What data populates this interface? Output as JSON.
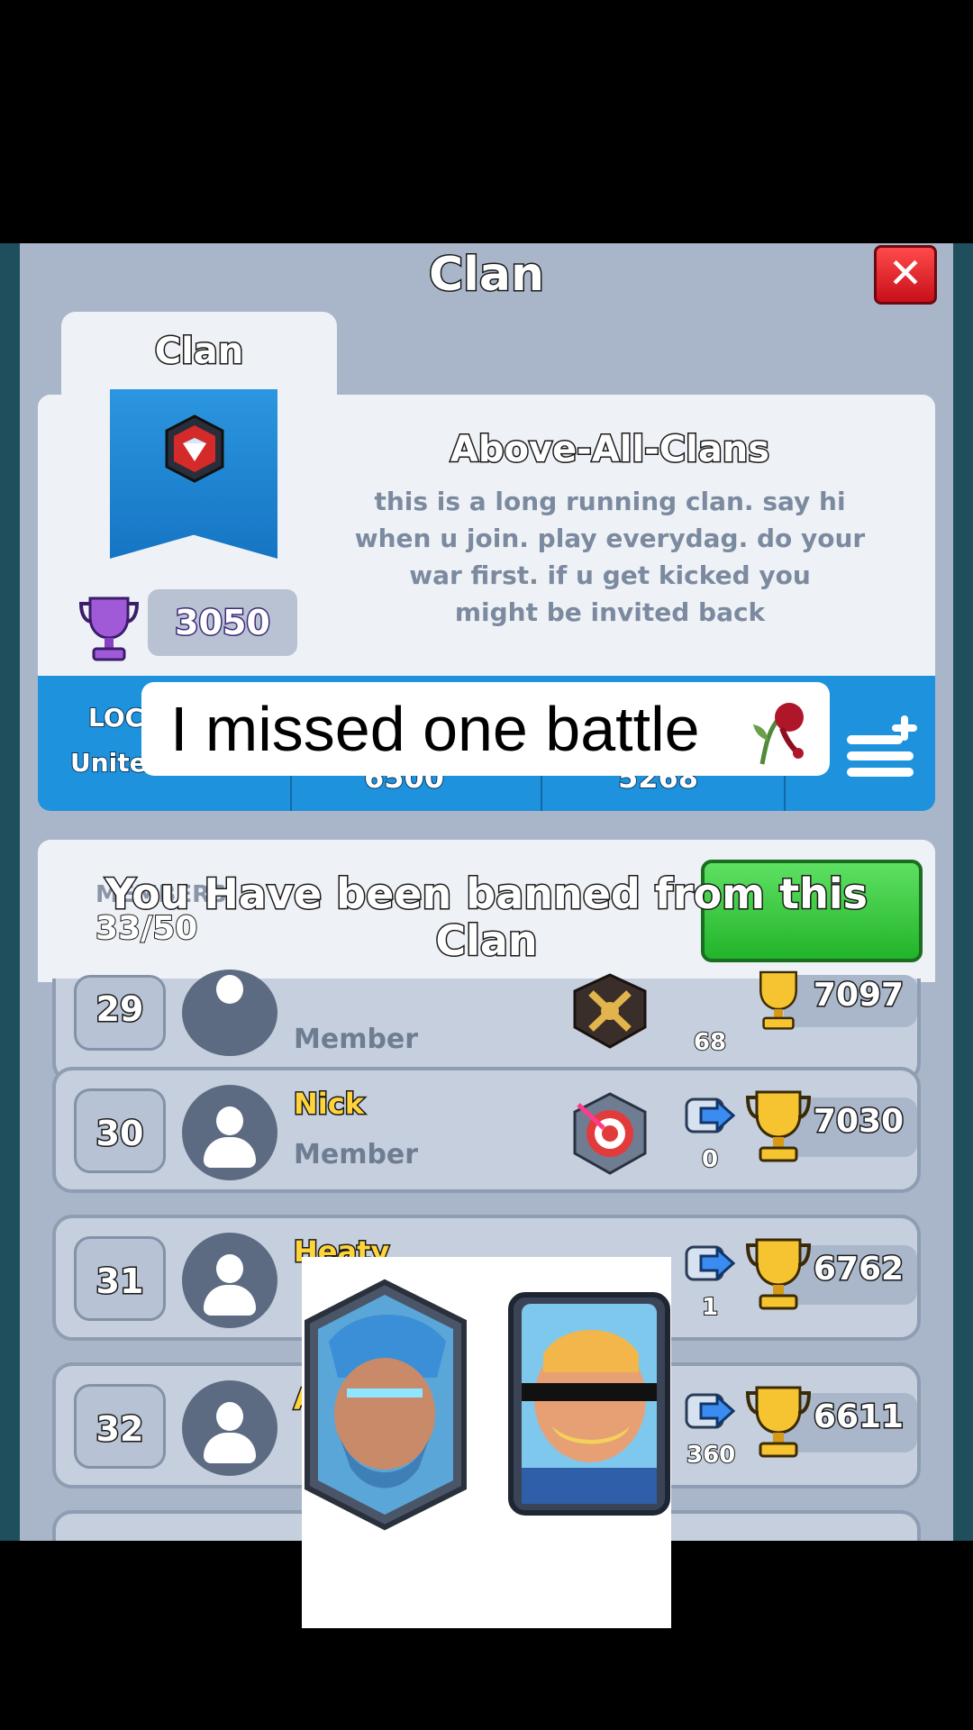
{
  "header": {
    "title": "Clan",
    "close_icon": "close-icon"
  },
  "tabs": [
    {
      "label": "Clan"
    }
  ],
  "clan": {
    "name": "Above-All-Clans",
    "description_lines": [
      "this is a long running clan. say hi",
      "when u join. play everydag. do your",
      "war first. if u get kicked you",
      "might be invited back"
    ],
    "trophies": "3050",
    "badge_icon": "clan-badge-icon"
  },
  "stats": {
    "location_label": "LOC",
    "location_value": "Unite",
    "col2_value": "6500",
    "col3_value": "5268"
  },
  "members": {
    "label": "MEMBERS",
    "count": "33/50",
    "banned_message_line1": "You Have been banned from this",
    "banned_message_line2": "Clan"
  },
  "rows": [
    {
      "rank": "29",
      "name": "",
      "role": "Member",
      "donations": "68",
      "trophies": "7097"
    },
    {
      "rank": "30",
      "name": "Nick",
      "role": "Member",
      "donations": "0",
      "trophies": "7030"
    },
    {
      "rank": "31",
      "name": "Heaty",
      "role": "",
      "donations": "1",
      "trophies": "6762"
    },
    {
      "rank": "32",
      "name": "A",
      "role": "",
      "donations": "360",
      "trophies": "6611"
    }
  ],
  "overlay": {
    "caption": "I missed one battle",
    "emoji": "wilted-rose"
  },
  "colors": {
    "panel": "#a9b6c9",
    "stats_blue": "#1e92dc",
    "join_green": "#22b42a",
    "close_red": "#c80f1a"
  }
}
